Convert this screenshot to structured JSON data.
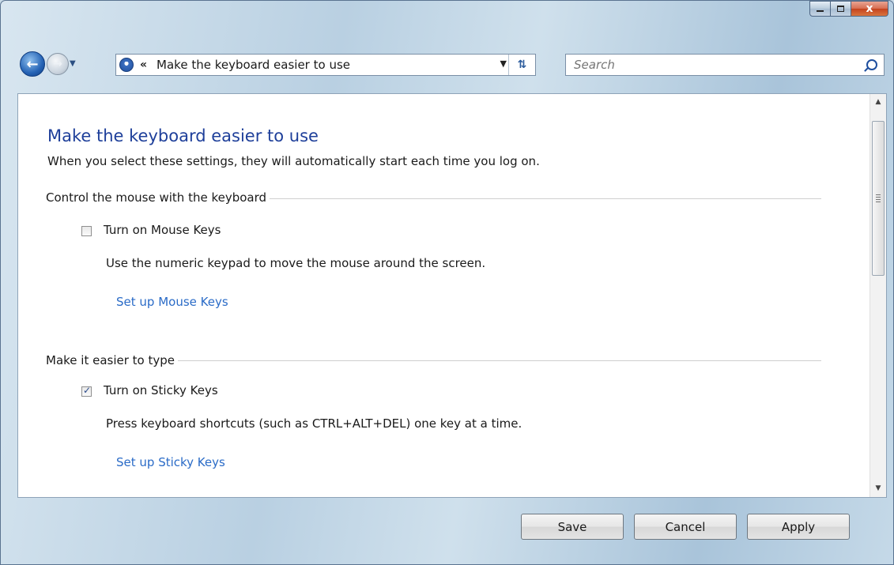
{
  "window": {
    "caption": {
      "minimize": "min-icon",
      "maximize": "max-icon",
      "close_label": "x"
    }
  },
  "nav": {
    "back_icon": "back-arrow-icon",
    "forward_icon": "forward-arrow-icon",
    "breadcrumb_sep": "«",
    "breadcrumb": "Make the keyboard easier to use",
    "search_placeholder": "Search"
  },
  "page": {
    "title": "Make the keyboard easier to use",
    "subtitle": "When you select these settings, they will automatically start each time you log on."
  },
  "sections": [
    {
      "heading": "Control the mouse with the keyboard",
      "checkbox_label": "Turn on Mouse Keys",
      "checked": false,
      "description": "Use the numeric keypad to move the mouse around the screen.",
      "link": "Set up Mouse Keys"
    },
    {
      "heading": "Make it easier to type",
      "checkbox_label": "Turn on Sticky Keys",
      "checked": true,
      "description": "Press keyboard shortcuts (such as CTRL+ALT+DEL) one key at a time.",
      "link": "Set up Sticky Keys"
    }
  ],
  "footer": {
    "save": "Save",
    "cancel": "Cancel",
    "apply": "Apply"
  },
  "colors": {
    "title_blue": "#1e3f9a",
    "link_blue": "#2a6bc7"
  }
}
